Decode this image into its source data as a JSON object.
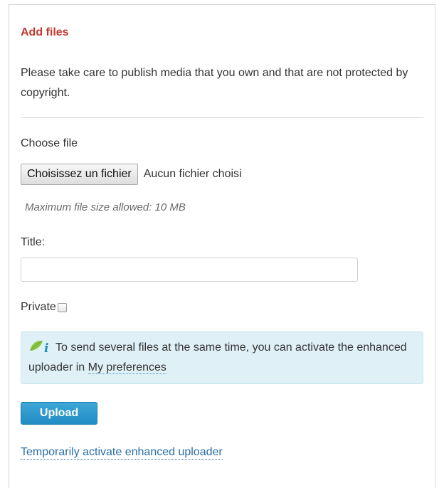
{
  "panel": {
    "title": "Add files",
    "intro": "Please take care to publish media that you own and that are not protected by copyright."
  },
  "file": {
    "label": "Choose file",
    "button_label": "Choisissez un fichier",
    "status": "Aucun fichier choisi",
    "hint": "Maximum file size allowed: 10 MB"
  },
  "title_field": {
    "label": "Title:",
    "value": "",
    "placeholder": ""
  },
  "private": {
    "label": "Private",
    "checked": false
  },
  "info": {
    "icon": "leaf-info-icon",
    "text": "To send several files at the same time, you can activate the enhanced uploader in ",
    "link_label": "My preferences"
  },
  "actions": {
    "upload_label": "Upload",
    "enhanced_link_label": "Temporarily activate enhanced uploader"
  },
  "colors": {
    "title": "#c0392b",
    "info_background": "#dff0f6",
    "upload_button": "#2196cc",
    "link": "#2a6ea6"
  }
}
